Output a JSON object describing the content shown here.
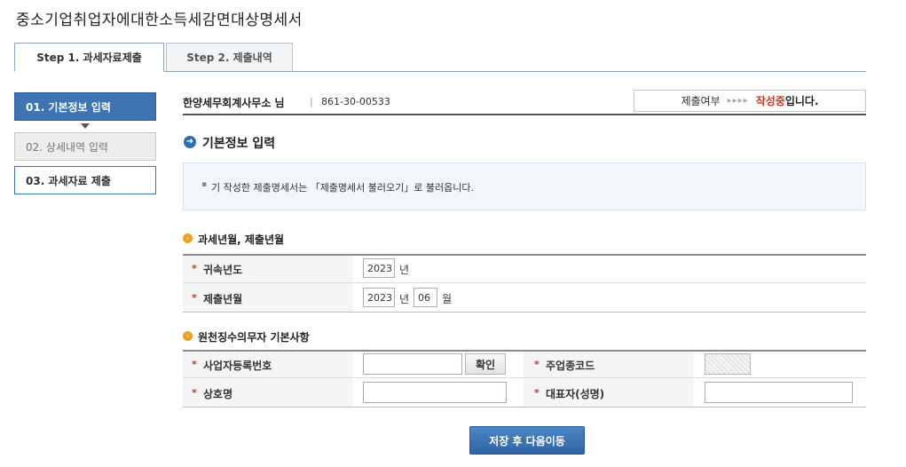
{
  "page": {
    "title": "중소기업취업자에대한소득세감면대상명세서"
  },
  "tabs": [
    {
      "label": "Step 1. 과세자료제출",
      "active": true
    },
    {
      "label": "Step 2. 제출내역",
      "active": false
    }
  ],
  "sidebar": {
    "items": [
      {
        "label": "01. 기본정보 입력",
        "state": "active"
      },
      {
        "label": "02. 상세내역 입력",
        "state": "disabled"
      },
      {
        "label": "03. 과세자료 제출",
        "state": "normal"
      }
    ]
  },
  "header": {
    "office_name": "한양세무회계사무소 님",
    "separator": "|",
    "business_number": "861-30-00533",
    "status_label": "제출여부",
    "status_arrows": "▸▸▸▸",
    "status_value": "작성중",
    "status_suffix": "입니다."
  },
  "section": {
    "title": "기본정보 입력",
    "info_bullet": "▪",
    "info_text": "기 작성한 제출명세서는 「제출명세서 불러오기」로 불러옵니다."
  },
  "period": {
    "title": "과세년월, 제출년월",
    "rows": [
      {
        "required": "*",
        "label": "귀속년도",
        "year": "2023",
        "year_unit": "년"
      },
      {
        "required": "*",
        "label": "제출년월",
        "year": "2023",
        "year_unit": "년",
        "month": "06",
        "month_unit": "월"
      }
    ]
  },
  "withholder": {
    "title": "원천징수의무자 기본사항",
    "required": "*",
    "business_reg_label": "사업자등록번호",
    "business_reg_value": "",
    "confirm_label": "확인",
    "industry_code_label": "주업종코드",
    "company_name_label": "상호명",
    "company_name_value": "",
    "representative_label": "대표자(성명)",
    "representative_value": ""
  },
  "actions": {
    "save_next_label": "저장 후 다음이동"
  },
  "colors": {
    "accent": "#3f74b4",
    "status": "#e0301e",
    "required": "#d0342c",
    "bullet_orange": "#f0a020"
  }
}
